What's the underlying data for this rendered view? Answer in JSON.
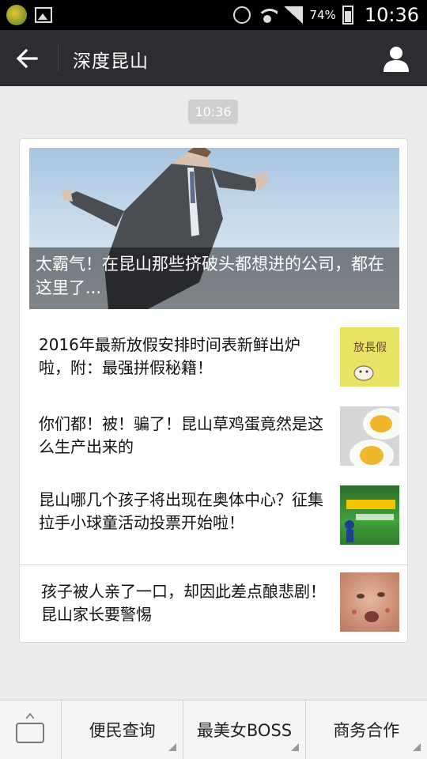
{
  "status_bar": {
    "battery_percent": "74%",
    "time": "10:36",
    "icons": [
      "app-notification-icon",
      "image-notification-icon",
      "alarm-icon",
      "wifi-icon",
      "signal-icon",
      "battery-icon"
    ]
  },
  "title_bar": {
    "title": "深度昆山",
    "back_icon": "arrow-left-icon",
    "profile_icon": "person-icon"
  },
  "message_time": "10:36",
  "articles": {
    "hero": {
      "caption": "太霸气！在昆山那些挤破头都想进的公司，都在这里了..."
    },
    "items": [
      {
        "title": "2016年最新放假安排时间表新鲜出炉啦，附：最强拼假秘籍！",
        "thumb_text": "放長假"
      },
      {
        "title": "你们都！被！骗了！昆山草鸡蛋竟然是这么生产出来的"
      },
      {
        "title": "昆山哪几个孩子将出现在奥体中心？征集拉手小球童活动投票开始啦！"
      },
      {
        "title": "孩子被人亲了一口，却因此差点酿悲剧！昆山家长要警惕"
      }
    ]
  },
  "bottom_menu": {
    "keyboard_icon": "keyboard-icon",
    "tabs": [
      "便民查询",
      "最美女BOSS",
      "商务合作"
    ]
  },
  "colors": {
    "titlebar_bg": "#2c2d31",
    "page_bg": "#ebebeb"
  }
}
